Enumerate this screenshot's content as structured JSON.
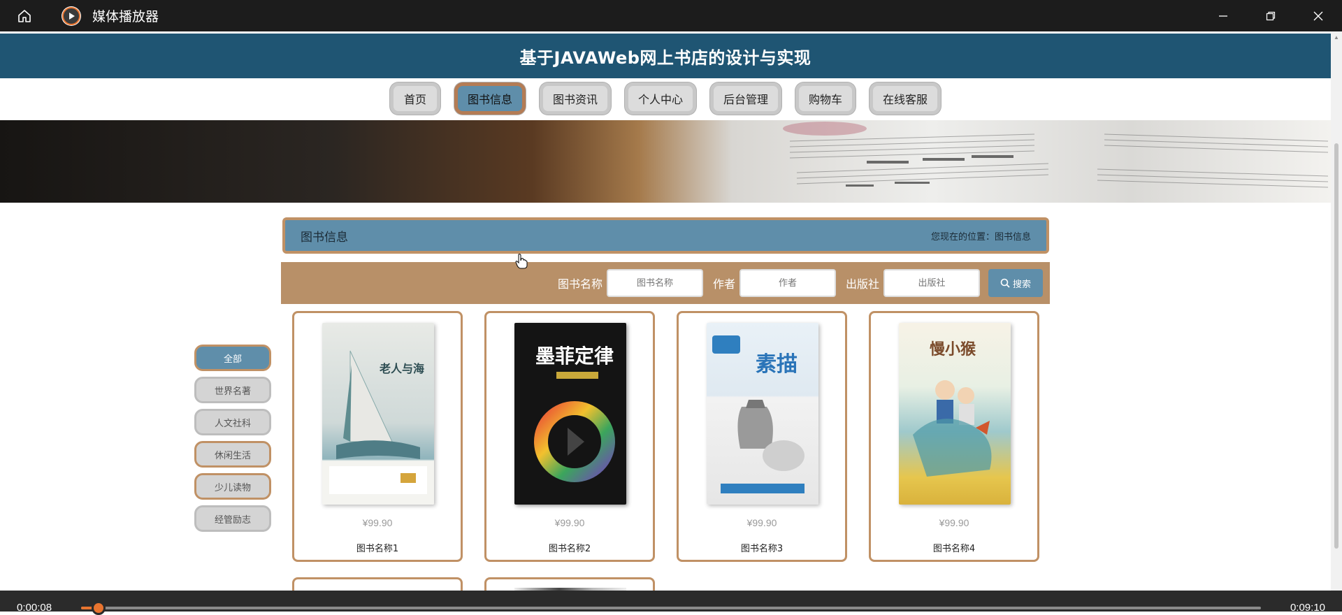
{
  "window": {
    "title": "媒体播放器"
  },
  "site": {
    "title": "基于JAVAWeb网上书店的设计与实现"
  },
  "nav": {
    "items": [
      "首页",
      "图书信息",
      "图书资讯",
      "个人中心",
      "后台管理",
      "购物车",
      "在线客服"
    ],
    "active_index": 1
  },
  "breadcrumb": {
    "title": "图书信息",
    "location": "您现在的位置：图书信息"
  },
  "search": {
    "name_label": "图书名称",
    "name_placeholder": "图书名称",
    "author_label": "作者",
    "author_placeholder": "作者",
    "publisher_label": "出版社",
    "publisher_placeholder": "出版社",
    "button_label": "搜索"
  },
  "categories": {
    "items": [
      "全部",
      "世界名著",
      "人文社科",
      "休闲生活",
      "少儿读物",
      "经管励志"
    ],
    "active_index": 0
  },
  "books": [
    {
      "price": "¥99.90",
      "name": "图书名称1",
      "cover_title": "老人与海"
    },
    {
      "price": "¥99.90",
      "name": "图书名称2",
      "cover_title": "墨菲定律"
    },
    {
      "price": "¥99.90",
      "name": "图书名称3",
      "cover_title": "素描"
    },
    {
      "price": "¥99.90",
      "name": "图书名称4",
      "cover_title": "慢小猴"
    }
  ],
  "player": {
    "current_time": "0:00:08",
    "total_time": "0:09:10",
    "progress": 0.015
  },
  "colors": {
    "header": "#1f5573",
    "accent_blue": "#5f8eaa",
    "accent_brown": "#c09165",
    "search_bar": "#b89068",
    "progress": "#e8742f"
  }
}
